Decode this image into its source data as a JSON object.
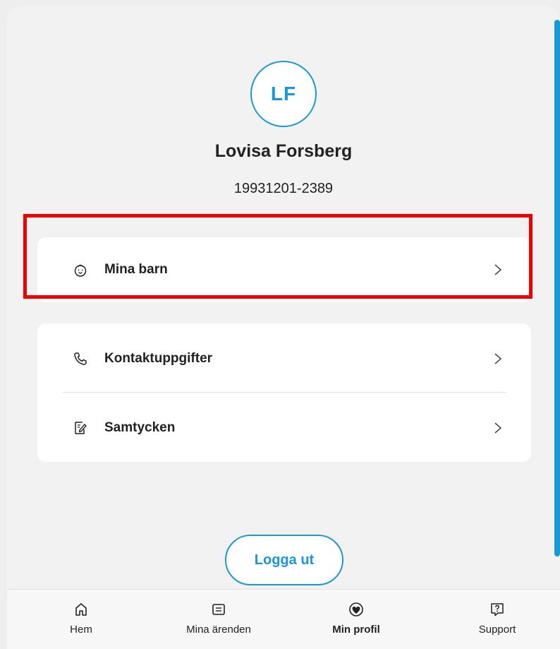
{
  "profile": {
    "initials": "LF",
    "name": "Lovisa Forsberg",
    "personal_number": "19931201-2389"
  },
  "menu": {
    "children": {
      "label": "Mina barn",
      "icon": "baby-icon"
    },
    "contact": {
      "label": "Kontaktuppgifter",
      "icon": "phone-icon"
    },
    "consent": {
      "label": "Samtycken",
      "icon": "document-edit-icon"
    }
  },
  "logout_label": "Logga ut",
  "tabs": [
    {
      "label": "Hem",
      "icon": "home-icon",
      "active": false
    },
    {
      "label": "Mina ärenden",
      "icon": "cases-icon",
      "active": false
    },
    {
      "label": "Min profil",
      "icon": "profile-heart-icon",
      "active": true
    },
    {
      "label": "Support",
      "icon": "question-icon",
      "active": false
    }
  ],
  "colors": {
    "accent": "#1a98d4",
    "highlight": "#ee0000",
    "text": "#222222",
    "background": "#f2f2f2"
  }
}
